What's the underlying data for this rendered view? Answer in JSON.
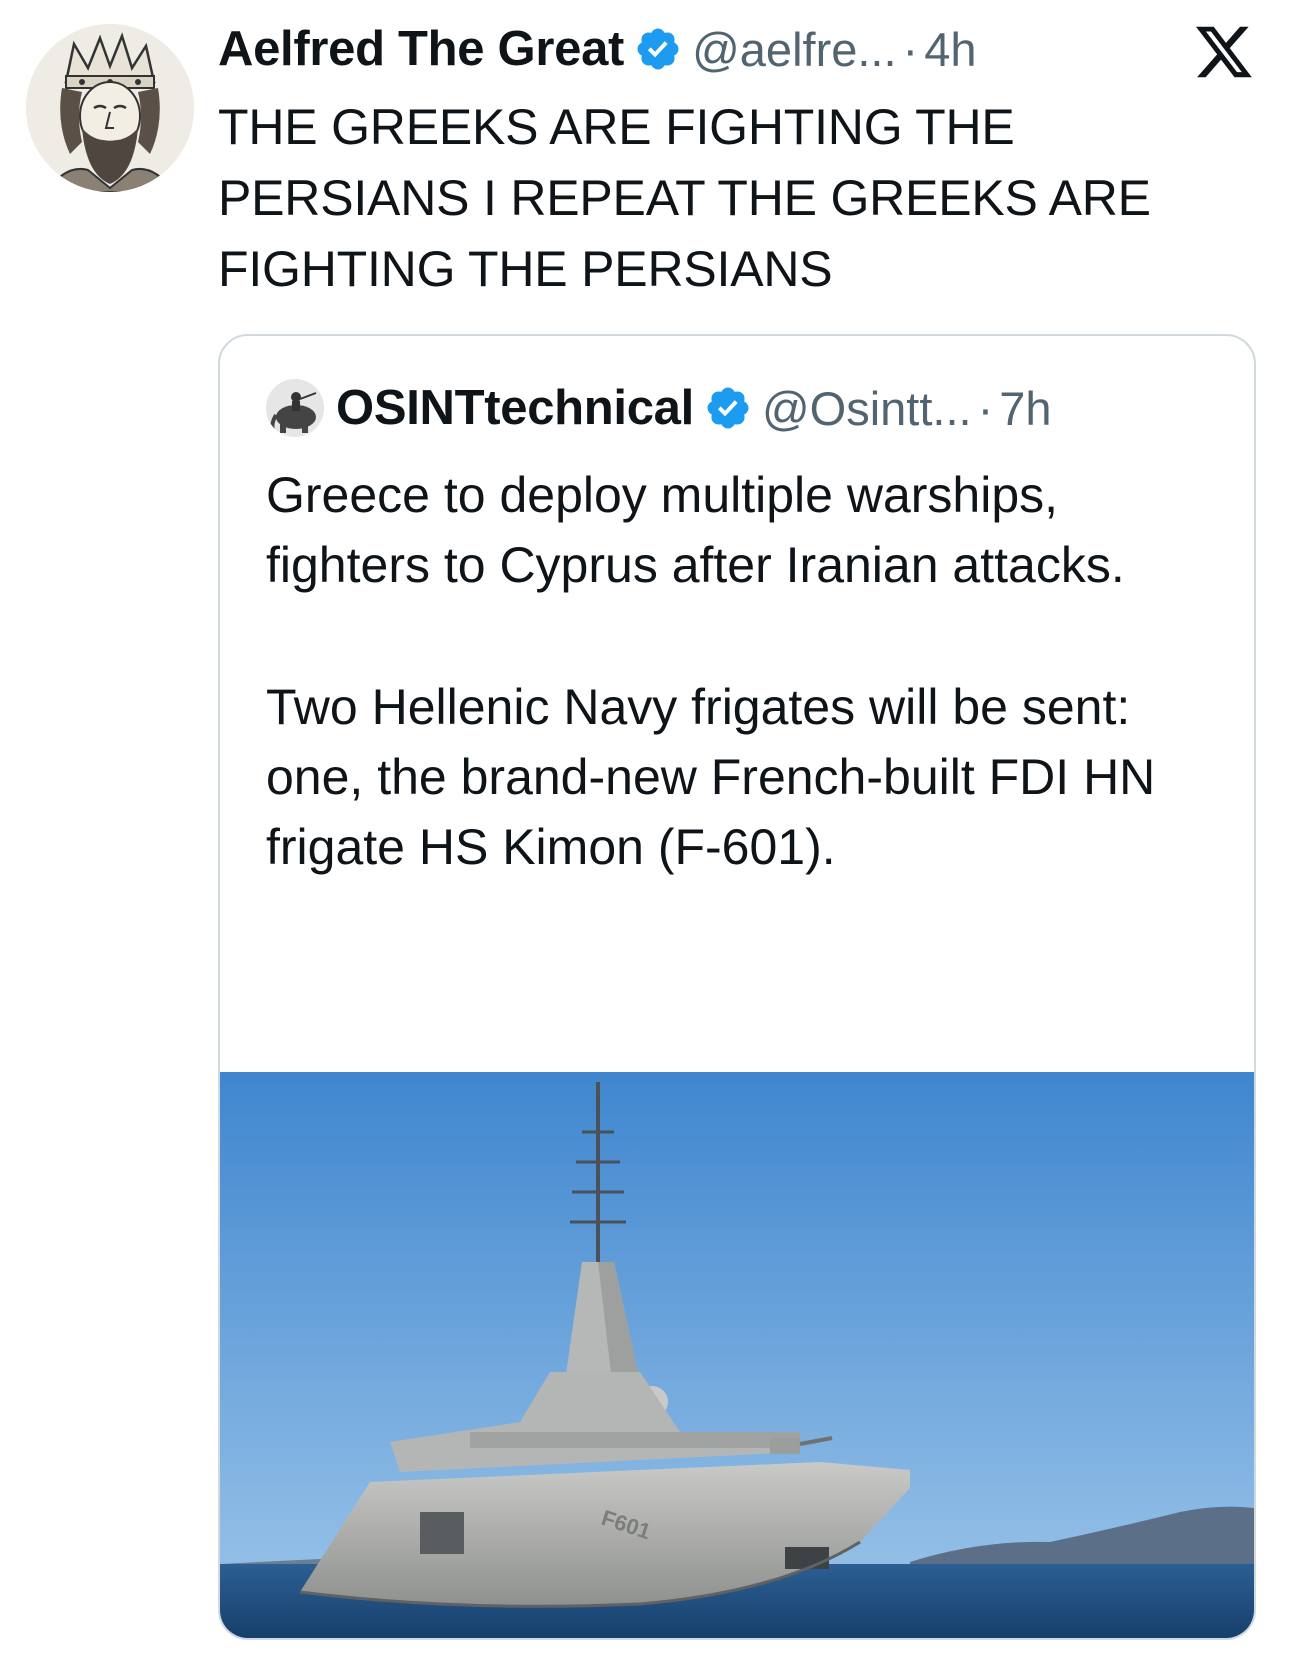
{
  "tweet": {
    "display_name": "Aelfred The Great",
    "verified_icon": "verified-badge-icon",
    "handle": "@aelfre...",
    "separator": "·",
    "time": "4h",
    "text": "THE GREEKS ARE FIGHTING THE PERSIANS I REPEAT THE GREEKS ARE FIGHTING THE PERSIANS",
    "avatar_icon": "crowned-king-portrait",
    "platform_logo": "x-logo-icon"
  },
  "quote": {
    "display_name": "OSINTtechnical",
    "verified_icon": "verified-badge-icon",
    "handle": "@Osintt...",
    "separator": "·",
    "time": "7h",
    "paragraphs": [
      "Greece to deploy multiple warships, fighters to Cyprus after Iranian attacks.",
      "Two Hellenic Navy frigates will be sent: one, the brand-new French-built FDI HN frigate HS Kimon (F-601)."
    ],
    "image_hull_marking": "F601",
    "image_icon": "frigate-photo"
  },
  "colors": {
    "text_primary": "#0f1419",
    "text_secondary": "#536471",
    "verified_blue": "#1d9bf0",
    "card_border": "#cfd9de"
  }
}
